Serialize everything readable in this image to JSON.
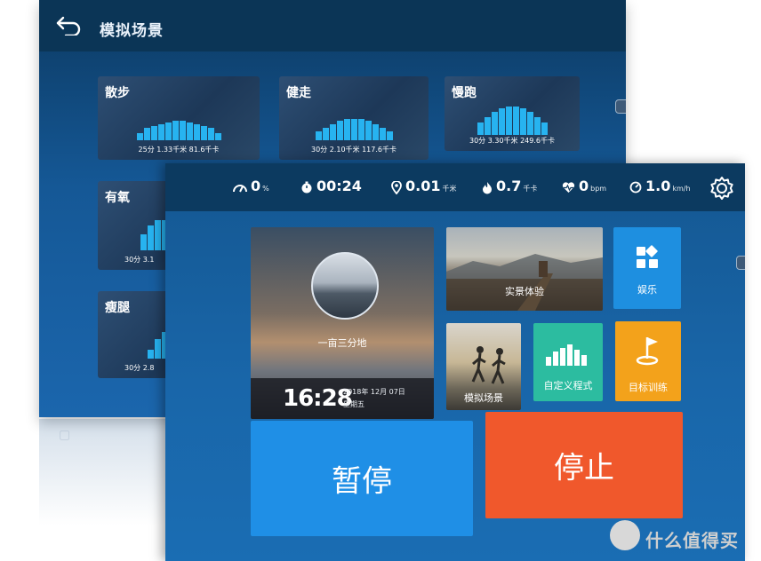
{
  "back_screen": {
    "title": "模拟场景",
    "cards": [
      {
        "title": "散步",
        "stats": "25分  1.33千米  81.6千卡"
      },
      {
        "title": "健走",
        "stats": "30分  2.10千米  117.6千卡"
      },
      {
        "title": "慢跑",
        "stats": "30分  3.30千米  249.6千卡"
      },
      {
        "title": "有氧",
        "stats": "30分  3.1"
      },
      {
        "title": "瘦腿",
        "stats": "30分  2.8"
      }
    ]
  },
  "front_screen": {
    "status": [
      {
        "icon": "incline-icon",
        "value": "0",
        "unit": "%"
      },
      {
        "icon": "timer-icon",
        "value": "00:24",
        "unit": ""
      },
      {
        "icon": "location-icon",
        "value": "0.01",
        "unit": "千米"
      },
      {
        "icon": "flame-icon",
        "value": "0.7",
        "unit": "千卡"
      },
      {
        "icon": "heart-icon",
        "value": "0",
        "unit": "bpm"
      },
      {
        "icon": "speed-icon",
        "value": "1.0",
        "unit": "km/h"
      }
    ],
    "main_tile": {
      "label": "一亩三分地",
      "time": "16:28",
      "date": "2018年 12月 07日",
      "weekday": "星期五"
    },
    "tiles": {
      "real_scene": "实景体验",
      "entertainment": "娱乐",
      "simulated_scene": "模拟场景",
      "custom_program": "自定义程式",
      "target_training": "目标训练"
    },
    "buttons": {
      "pause": "暂停",
      "stop": "停止"
    }
  },
  "watermark": "什么值得买",
  "colors": {
    "bar": "#27b3f0",
    "pause": "#1f8fe6",
    "stop": "#f0582c",
    "entertainment": "#1e8fe0",
    "custom": "#2cbca0",
    "target": "#f3a21b"
  }
}
